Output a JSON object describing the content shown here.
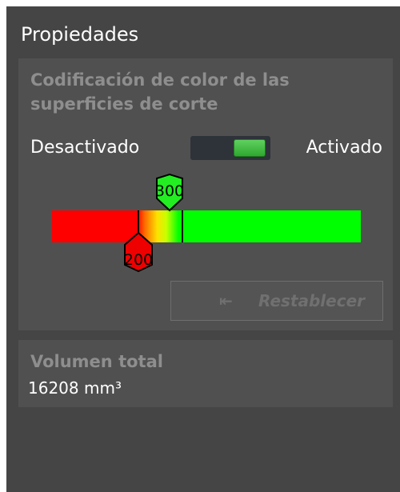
{
  "panel": {
    "title": "Propiedades"
  },
  "color_coding": {
    "title": "Codificación de color de las superficies de corte",
    "toggle": {
      "off_label": "Desactivado",
      "on_label": "Activado",
      "state": "on"
    },
    "lower_threshold": "200",
    "upper_threshold": "300",
    "colors": {
      "below": "#ff0000",
      "above": "#00ff00",
      "transition": "#ffff00"
    },
    "reset_label": "Restablecer",
    "reset_icon": "step-back-icon"
  },
  "volume": {
    "title": "Volumen total",
    "value": "16208 mm³"
  }
}
